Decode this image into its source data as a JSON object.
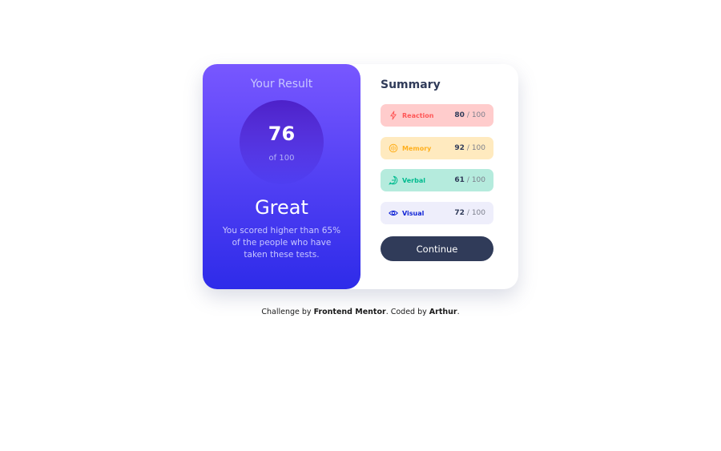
{
  "result": {
    "title": "Your Result",
    "score": "76",
    "of": "of 100",
    "rating": "Great",
    "description": "You scored higher than 65% of the people who have taken these tests."
  },
  "summary": {
    "title": "Summary",
    "items": [
      {
        "label": "Reaction",
        "score": "80",
        "max": "/ 100",
        "icon": "lightning-icon",
        "color": "#ff5757"
      },
      {
        "label": "Memory",
        "score": "92",
        "max": "/ 100",
        "icon": "brain-icon",
        "color": "#ffb01f"
      },
      {
        "label": "Verbal",
        "score": "61",
        "max": "/ 100",
        "icon": "chat-icon",
        "color": "#00bb8f"
      },
      {
        "label": "Visual",
        "score": "72",
        "max": "/ 100",
        "icon": "eye-icon",
        "color": "#1125d6"
      }
    ],
    "continue_label": "Continue"
  },
  "footer": {
    "prefix": "Challenge by ",
    "challenge_link": "Frontend Mentor",
    "middle": ". Coded by ",
    "author_link": "Arthur",
    "suffix": "."
  }
}
